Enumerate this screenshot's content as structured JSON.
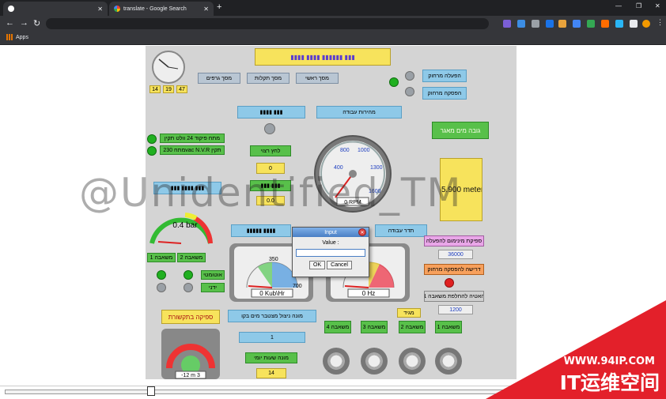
{
  "browser": {
    "tabs": [
      {
        "title": "",
        "active": false
      },
      {
        "title": "translate - Google Search",
        "active": true
      }
    ],
    "bookmarks": [
      {
        "label": "Apps"
      }
    ]
  },
  "hmi": {
    "clock": {
      "hours": "14",
      "minutes": "19",
      "seconds": "47"
    },
    "nav_buttons": [
      "מסך ראשי",
      "מסך תקלות",
      "מסך גרפים"
    ],
    "start_pump_label": "הפעלה מרחוק",
    "stop_pump_label": "הפסקה מרחוק",
    "gauge_high_label": "גובה מים מאגר",
    "level_value": "-5.900 meter",
    "rpm_gauge": {
      "value": "0 RPM",
      "ticks": [
        "400",
        "800",
        "1000",
        "1300",
        "1600"
      ]
    },
    "work_speed_label": "מהירות עבודה",
    "control_24v_label": "מתח פיקוד 24 וולט תקין",
    "nvr_label": "מתח 230vac N.V.R תקין",
    "pressure_label": "לחץ רצוי",
    "pressure_set_value": "0",
    "small_value": "0.0",
    "pressure_gauge": {
      "value": "0.4 bar"
    },
    "pump_buttons_left": [
      "משאבה 1",
      "משאבה 2"
    ],
    "auto_label": "אוטומטי",
    "manual_label": "ידני",
    "flow_gauge": {
      "value": "0 Kub\\Hr",
      "ticks": [
        "350",
        "700"
      ]
    },
    "freq_gauge": {
      "value": "0 Hz"
    },
    "freq_label": "תדר עבודה",
    "min_flow_label": "ספיקת מינימום להפעלה",
    "min_flow_value": "36000",
    "remote_req_label": "דרישה להפסקה מרחוק",
    "pump_change_label": "האטיה להחלפת משאבה 1",
    "pump_change_value": "1200",
    "comm_flow_label": "ספיקה בתקשורת",
    "tank_gauge": {
      "value": "-12 m 3"
    },
    "meter_label": "מונה ניצול מצטבר מים בקו",
    "meter_value": "1",
    "daily_label": "מונה שעות יומי",
    "daily_value": "14",
    "selector_label": "מגיד",
    "pump_buttons_right": [
      "משאבה 4",
      "משאבה 3",
      "משאבה 2",
      "משאבה 1"
    ]
  },
  "dialog": {
    "title": "Input",
    "prompt": "Value :",
    "input_value": "",
    "ok_label": "OK",
    "cancel_label": "Cancel"
  },
  "watermark": "@Unidentified_TM",
  "brand": {
    "url": "WWW.94IP.COM",
    "name": "IT运维空间"
  }
}
